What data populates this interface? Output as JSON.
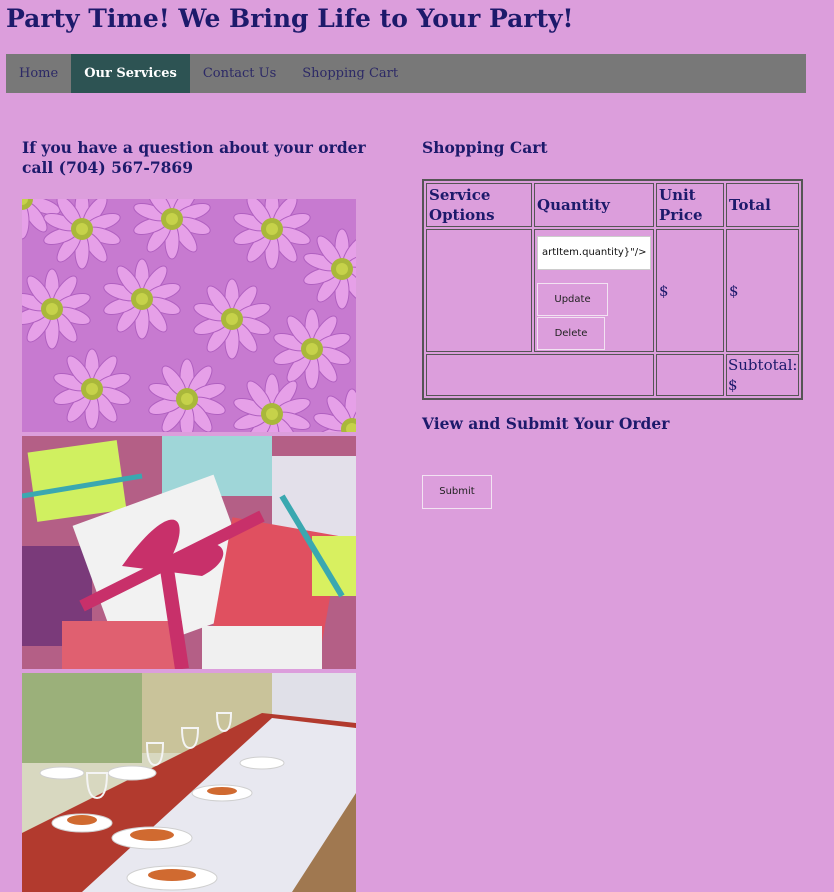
{
  "site": {
    "title": "Party Time! We Bring Life to Your Party!"
  },
  "nav": {
    "items": [
      {
        "label": "Home"
      },
      {
        "label": "Our Services"
      },
      {
        "label": "Contact Us"
      },
      {
        "label": "Shopping Cart"
      }
    ],
    "active": "Our Services"
  },
  "contact": {
    "question": "If you have a question about your order call (704) 567-7869"
  },
  "photos": [
    "flowers-photo",
    "gifts-photo",
    "banquet-table-photo"
  ],
  "cart": {
    "title": "Shopping Cart",
    "headers": {
      "service": "Service Options",
      "quantity": "Quantity",
      "unit_price": "Unit Price",
      "total": "Total"
    },
    "row": {
      "quantity_value": "artItem.quantity}\"/>",
      "update_label": "Update",
      "delete_label": "Delete",
      "unit_price": "$",
      "total": "$"
    },
    "subtotal_label": "Subtotal:",
    "subtotal_value": "$"
  },
  "submit": {
    "title": "View and Submit Your Order",
    "button_label": "Submit"
  },
  "colors": {
    "background": "#dc9edc",
    "nav_bg": "#787878",
    "nav_active": "#2d5353",
    "heading": "#1d1a6b"
  }
}
